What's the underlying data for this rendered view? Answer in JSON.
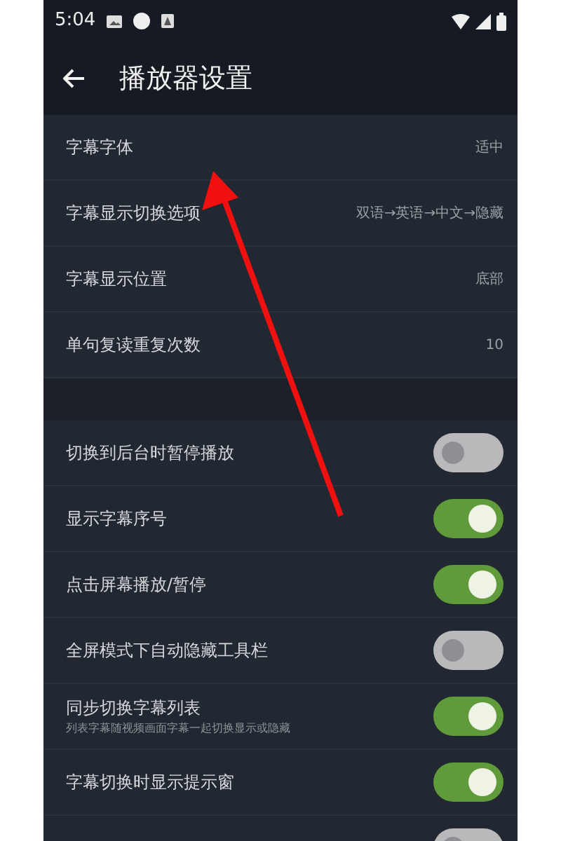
{
  "status_bar": {
    "time": "5:04"
  },
  "header": {
    "title": "播放器设置"
  },
  "options": [
    {
      "label": "字幕字体",
      "value": "适中"
    },
    {
      "label": "字幕显示切换选项",
      "value": "双语→英语→中文→隐藏"
    },
    {
      "label": "字幕显示位置",
      "value": "底部"
    },
    {
      "label": "单句复读重复次数",
      "value": "10"
    }
  ],
  "toggles": [
    {
      "label": "切换到后台时暂停播放",
      "on": false
    },
    {
      "label": "显示字幕序号",
      "on": true
    },
    {
      "label": "点击屏幕播放/暂停",
      "on": true
    },
    {
      "label": "全屏模式下自动隐藏工具栏",
      "on": false
    },
    {
      "label": "同步切换字幕列表",
      "description": "列表字幕随视频画面字幕一起切换显示或隐藏",
      "on": true
    },
    {
      "label": "字幕切换时显示提示窗",
      "on": true
    },
    {
      "on": false
    }
  ]
}
